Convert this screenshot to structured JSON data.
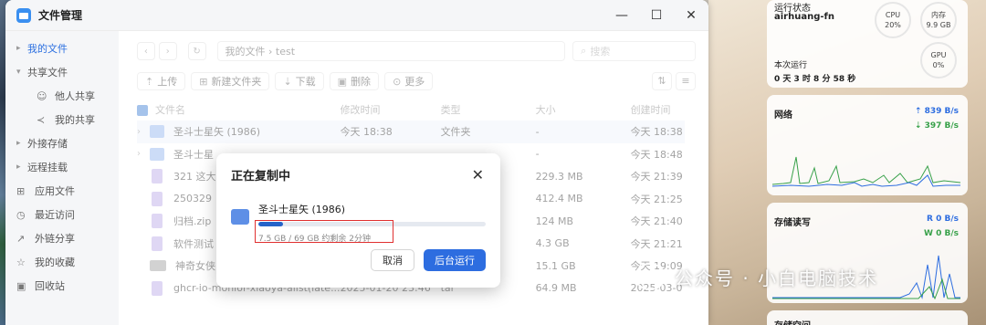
{
  "window": {
    "title": "文件管理",
    "controls": [
      "—",
      "☐",
      "✕"
    ]
  },
  "sidebar": {
    "items": [
      {
        "label": "我的文件",
        "icon": "▸",
        "active": true
      },
      {
        "label": "共享文件",
        "icon": "▸"
      },
      {
        "label": "他人共享",
        "icon": "👤",
        "sub": true
      },
      {
        "label": "我的共享",
        "icon": "⤴",
        "sub": true
      },
      {
        "label": "外接存储",
        "icon": "▸"
      },
      {
        "label": "远程挂载",
        "icon": "▸"
      },
      {
        "label": "应用文件",
        "icon": "⚙"
      },
      {
        "label": "最近访问",
        "icon": "◷"
      },
      {
        "label": "外链分享",
        "icon": "↗"
      },
      {
        "label": "我的收藏",
        "icon": "☆"
      },
      {
        "label": "回收站",
        "icon": "🗑"
      }
    ]
  },
  "nav": {
    "path": "我的文件 › test",
    "search_placeholder": "搜索"
  },
  "toolbar": {
    "upload": "上传",
    "new_folder": "新建文件夹",
    "download": "下载",
    "delete": "删除",
    "more": "更多"
  },
  "table": {
    "headers": [
      "文件名",
      "修改时间",
      "类型",
      "大小",
      "创建时间"
    ],
    "rows": [
      {
        "name": "圣斗士星矢 (1986)",
        "modified": "今天 18:38",
        "type": "文件夹",
        "size": "-",
        "created": "今天 18:38",
        "kind": "folder",
        "expand": true
      },
      {
        "name": "圣斗士星",
        "modified": "",
        "type": "",
        "size": "-",
        "created": "今天 18:48",
        "kind": "folder",
        "expand": true
      },
      {
        "name": "321 这大",
        "modified": "",
        "type": "",
        "size": "229.3 MB",
        "created": "今天 21:39",
        "kind": "file"
      },
      {
        "name": "250329",
        "modified": "",
        "type": "",
        "size": "412.4 MB",
        "created": "今天 21:25",
        "kind": "file"
      },
      {
        "name": "归档.zip",
        "modified": "",
        "type": "",
        "size": "124 MB",
        "created": "今天 21:40",
        "kind": "file"
      },
      {
        "name": "软件测试",
        "modified": "",
        "type": "",
        "size": "4.3 GB",
        "created": "今天 21:21",
        "kind": "file"
      },
      {
        "name": "神奇女侠",
        "modified": "",
        "type": "",
        "size": "15.1 GB",
        "created": "今天 19:09",
        "kind": "img"
      },
      {
        "name": "ghcr-io-monlor-xiaoya-alist(late...",
        "modified": "2025-01-20 23:46",
        "type": "tar",
        "size": "64.9 MB",
        "created": "2025-03-0",
        "kind": "file"
      }
    ]
  },
  "dialog": {
    "title": "正在复制中",
    "close": "✕",
    "file_name": "圣斗士星矢 (1986)",
    "progress": 0.11,
    "progress_text": "7.5 GB / 69 GB 约剩余 2分钟",
    "cancel": "取消",
    "background": "后台运行"
  },
  "widgets": {
    "status": {
      "title": "运行状态",
      "host": "airhuang-fn",
      "cpu_label": "CPU",
      "cpu_value": "20%",
      "mem_label": "内存",
      "mem_value": "9.9 GB",
      "gpu_label": "GPU",
      "gpu_value": "0%",
      "uptime_label": "本次运行",
      "uptime_value": "0 天 3 时 8 分 58 秒"
    },
    "network": {
      "title": "网络",
      "up": "⇡ 839 B/s",
      "down": "⇣ 397 B/s"
    },
    "storage_io": {
      "title": "存储读写",
      "read": "R 0 B/s",
      "write": "W 0 B/s"
    },
    "storage_space": {
      "title": "存储空间"
    }
  },
  "watermark": {
    "text": "公众号 · 小白电脑技术"
  },
  "colors": {
    "accent": "#2d6de0",
    "highlight_box": "#e03030",
    "download_rate": "#38a14a"
  }
}
